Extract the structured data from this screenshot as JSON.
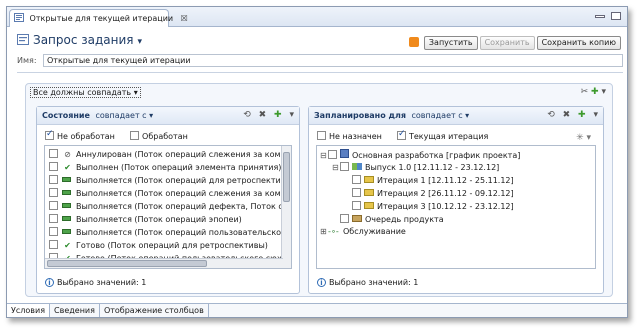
{
  "tab": {
    "label": "Открытые для текущей итерации",
    "close": "☒"
  },
  "header": {
    "title": "Запрос задания",
    "title_arrow": "▾",
    "buttons": {
      "run": "Запустить",
      "save": "Сохранить",
      "save_copy": "Сохранить копию"
    }
  },
  "name_field": {
    "label": "Имя:",
    "value": "Открытые для текущей итерации"
  },
  "conditions": {
    "heading": "Все должны совпадать",
    "heading_arrow": "▾"
  },
  "left_panel": {
    "attr": "Состояние",
    "modifier": "совпадает с",
    "modifier_arrow": "▾",
    "filters": {
      "unresolved": "Не обработан",
      "resolved": "Обработан"
    },
    "items": [
      {
        "icon": "cancel-icon",
        "label": "Аннулирован (Поток операций слежения за компл"
      },
      {
        "icon": "check-icon",
        "label": "Выполнен (Поток операций элемента принятия)"
      },
      {
        "icon": "progress-icon",
        "label": "Выполняется (Поток операций для ретроспективы)"
      },
      {
        "icon": "progress-icon",
        "label": "Выполняется (Поток операций слежения за компо"
      },
      {
        "icon": "progress-icon",
        "label": "Выполняется (Поток операций дефекта, Поток опе"
      },
      {
        "icon": "progress-icon",
        "label": "Выполняется (Поток операций эпопеи)"
      },
      {
        "icon": "progress-icon",
        "label": "Выполняется (Поток операций пользовательского"
      },
      {
        "icon": "check-icon",
        "label": "Готово (Поток операций для ретроспективы)"
      },
      {
        "icon": "check-icon",
        "label": "Готово (Поток операций пользовательского сюже"
      }
    ],
    "count": "Выбрано значений: 1"
  },
  "right_panel": {
    "attr": "Запланировано для",
    "modifier": "совпадает с",
    "modifier_arrow": "▾",
    "filters": {
      "unassigned": "Не назначен",
      "current": "Текущая итерация"
    },
    "tree": [
      {
        "label": "Основная разработка [график проекта]",
        "icon": "timeline",
        "level": 0,
        "toggle": "⊟"
      },
      {
        "label": "Выпуск 1.0 [12.11.12 - 23.12.12]",
        "icon": "rel",
        "level": 1,
        "toggle": "⊟"
      },
      {
        "label": "Итерация 1 [12.11.12 - 25.11.12]",
        "icon": "it",
        "level": 2,
        "toggle": ""
      },
      {
        "label": "Итерация 2 [26.11.12 - 09.12.12]",
        "icon": "it",
        "level": 2,
        "toggle": ""
      },
      {
        "label": "Итерация 3 [10.12.12 - 23.12.12]",
        "icon": "it",
        "level": 2,
        "toggle": ""
      },
      {
        "label": "Очередь продукта",
        "icon": "bk",
        "level": 1,
        "toggle": ""
      },
      {
        "label": "Обслуживание",
        "icon": "maint",
        "level": 0,
        "toggle": "⊞"
      }
    ],
    "count": "Выбрано значений: 1"
  },
  "bottom_tabs": [
    "Условия",
    "Сведения",
    "Отображение столбцов"
  ]
}
